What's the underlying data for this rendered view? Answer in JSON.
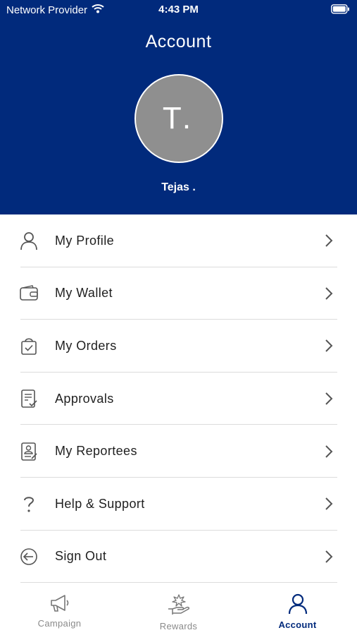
{
  "status_bar": {
    "carrier": "Network Provider",
    "time": "4:43 PM"
  },
  "header": {
    "title": "Account",
    "avatar_initials": "T.",
    "user_name": "Tejas ."
  },
  "menu": {
    "items": [
      {
        "label": "My Profile",
        "icon": "user-icon"
      },
      {
        "label": "My Wallet",
        "icon": "wallet-icon"
      },
      {
        "label": "My Orders",
        "icon": "shopping-bag-icon"
      },
      {
        "label": "Approvals",
        "icon": "document-check-icon"
      },
      {
        "label": "My Reportees",
        "icon": "id-badge-icon"
      },
      {
        "label": "Help & Support",
        "icon": "question-icon"
      },
      {
        "label": "Sign Out",
        "icon": "sign-out-icon"
      }
    ]
  },
  "tab_bar": {
    "tabs": [
      {
        "label": "Campaign",
        "icon": "megaphone-icon",
        "active": false
      },
      {
        "label": "Rewards",
        "icon": "reward-hand-icon",
        "active": false
      },
      {
        "label": "Account",
        "icon": "user-icon",
        "active": true
      }
    ]
  },
  "colors": {
    "header_bg": "#012A7C",
    "active_tab": "#012A7C",
    "avatar_bg": "#8F8F8F"
  }
}
